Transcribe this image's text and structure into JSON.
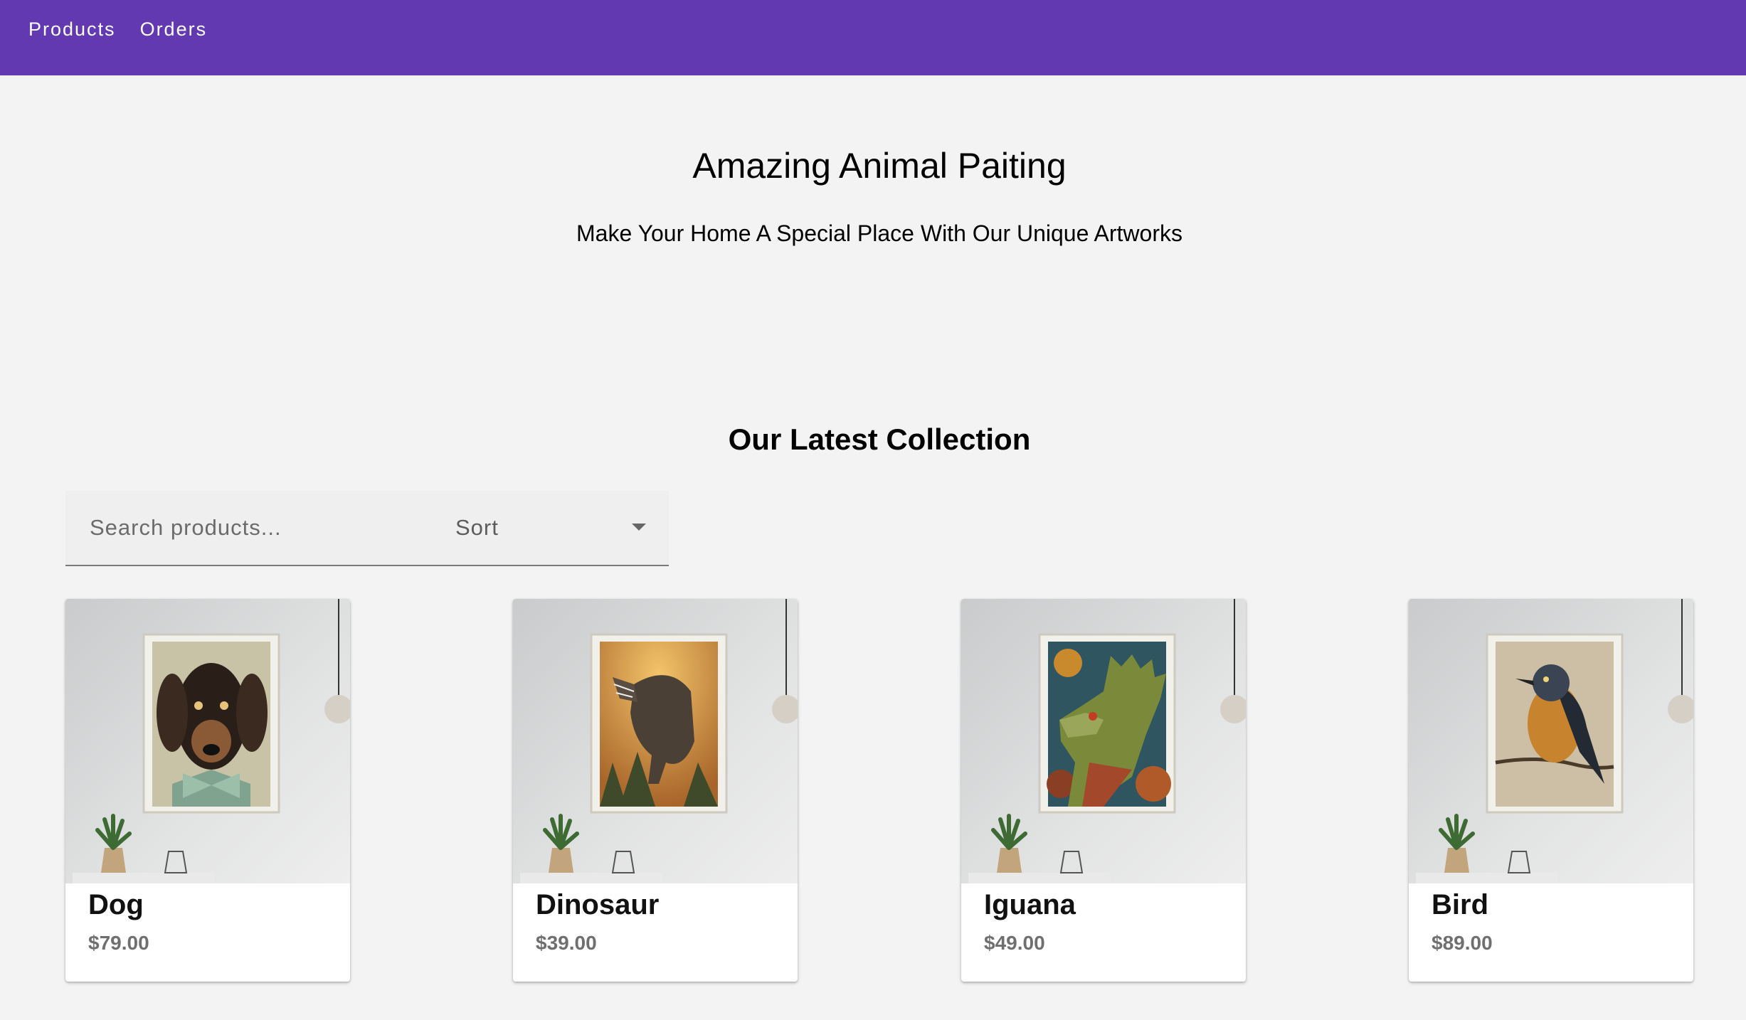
{
  "nav": {
    "items": [
      {
        "label": "Products"
      },
      {
        "label": "Orders"
      }
    ]
  },
  "hero": {
    "title": "Amazing Animal Paiting",
    "subtitle": "Make Your Home A Special Place With Our Unique Artworks"
  },
  "collection": {
    "title": "Our Latest Collection",
    "search_placeholder": "Search products...",
    "sort_label": "Sort"
  },
  "products": [
    {
      "name": "Dog",
      "price": "$79.00",
      "art": "dachshund-painting"
    },
    {
      "name": "Dinosaur",
      "price": "$39.00",
      "art": "t-rex-painting"
    },
    {
      "name": "Iguana",
      "price": "$49.00",
      "art": "iguana-painting"
    },
    {
      "name": "Bird",
      "price": "$89.00",
      "art": "bird-painting"
    }
  ],
  "colors": {
    "appbar": "#6339b2",
    "background": "#f3f3f3",
    "price": "#6f6f6f"
  }
}
